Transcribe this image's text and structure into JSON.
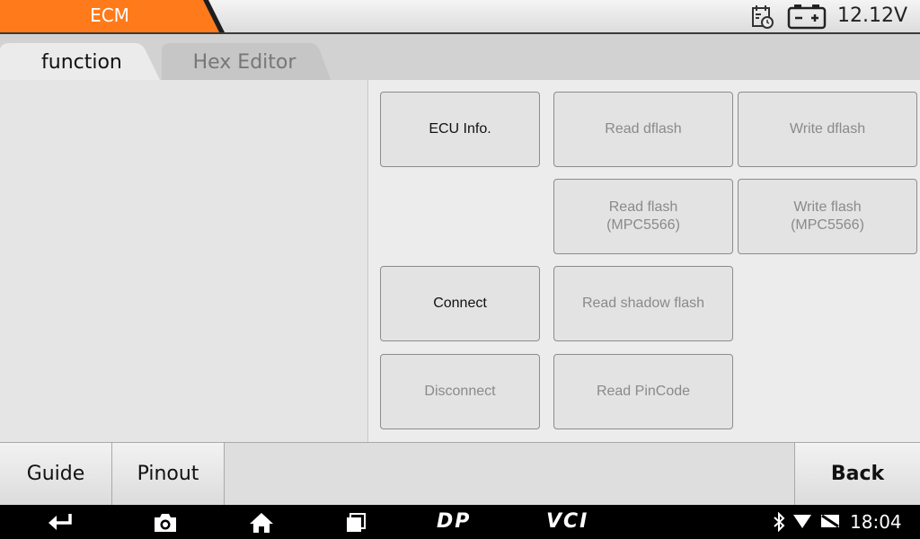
{
  "header": {
    "title": "ECM",
    "voltage": "12.12V",
    "title_color": "#ff7a1a",
    "icons": [
      "calendar-clock-icon",
      "battery-icon"
    ]
  },
  "tabs": [
    {
      "label": "function",
      "active": true
    },
    {
      "label": "Hex Editor",
      "active": false
    }
  ],
  "functions": {
    "ecu_info": {
      "label": "ECU Info.",
      "enabled": true
    },
    "read_dflash": {
      "label": "Read dflash",
      "enabled": false
    },
    "write_dflash": {
      "label": "Write dflash",
      "enabled": false
    },
    "read_flash": {
      "label": "Read flash\n(MPC5566)",
      "enabled": false
    },
    "write_flash": {
      "label": "Write flash\n(MPC5566)",
      "enabled": false
    },
    "connect": {
      "label": "Connect",
      "enabled": true
    },
    "read_shadow_flash": {
      "label": "Read shadow flash",
      "enabled": false
    },
    "disconnect": {
      "label": "Disconnect",
      "enabled": false
    },
    "read_pincode": {
      "label": "Read PinCode",
      "enabled": false
    }
  },
  "bottom": {
    "guide": "Guide",
    "pinout": "Pinout",
    "back": "Back"
  },
  "navbar": {
    "dp_label": "DP",
    "vci_label": "VCI",
    "time": "18:04",
    "icons": [
      "back-icon",
      "camera-icon",
      "home-icon",
      "recents-icon",
      "bluetooth-icon",
      "wifi-icon",
      "no-sim-icon"
    ]
  }
}
